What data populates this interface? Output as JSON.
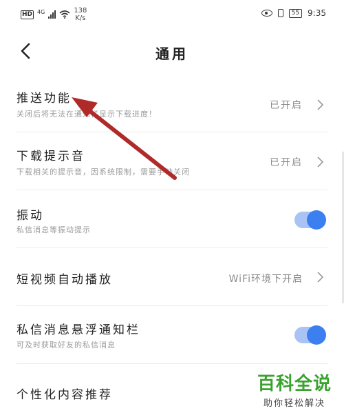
{
  "status_bar": {
    "hd": "HD",
    "network": "4G",
    "speed_value": "138",
    "speed_unit": "K/s",
    "battery": "55",
    "time": "9:35",
    "icons": [
      "eye-comfort-icon",
      "vibrate-icon",
      "wifi-icon",
      "signal-icon"
    ]
  },
  "header": {
    "title": "通用",
    "back_icon": "chevron-left-icon"
  },
  "settings": {
    "push": {
      "title": "推送功能",
      "subtitle": "关闭后将无法在通知栏显示下载进度！",
      "status": "已开启"
    },
    "download_sound": {
      "title": "下载提示音",
      "subtitle": "下载相关的提示音，因系统限制，需要手动关闭",
      "status": "已开启"
    },
    "vibration": {
      "title": "振动",
      "subtitle": "私信消息等振动提示",
      "enabled": true
    },
    "autoplay": {
      "title": "短视频自动播放",
      "status": "WiFi环境下开启"
    },
    "dm_float": {
      "title": "私信消息悬浮通知栏",
      "subtitle": "可及时获取好友的私信消息",
      "enabled": true
    },
    "personalized": {
      "title": "个性化内容推荐"
    }
  },
  "watermark": {
    "main": "百科全说",
    "sub": "助你轻松解决"
  },
  "colors": {
    "accent": "#3b7ff0",
    "toggle_track": "#a9c3f4",
    "annotation_arrow": "#b02a2a",
    "watermark_green": "#3aa22e"
  }
}
